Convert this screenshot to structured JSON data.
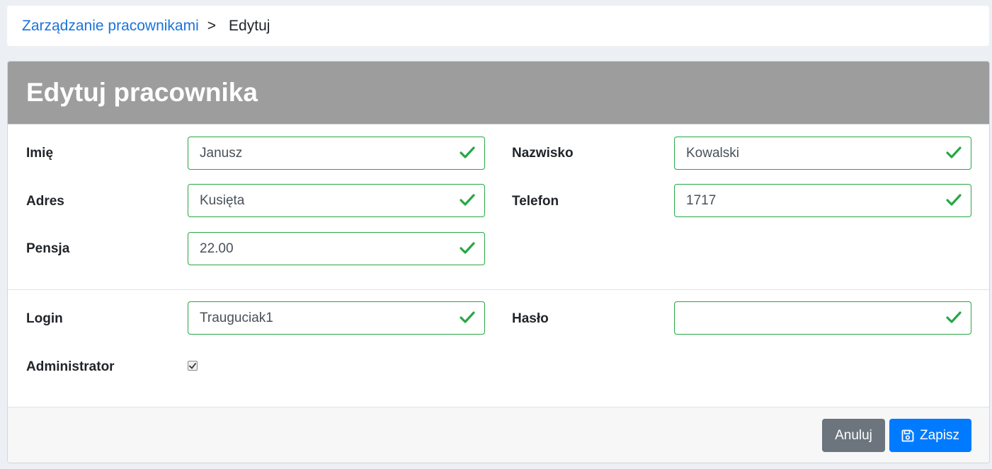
{
  "breadcrumb": {
    "parent": "Zarządzanie pracownikami",
    "separator": ">",
    "current": "Edytuj"
  },
  "card": {
    "title": "Edytuj pracownika"
  },
  "form": {
    "first_name": {
      "label": "Imię",
      "value": "Janusz"
    },
    "last_name": {
      "label": "Nazwisko",
      "value": "Kowalski"
    },
    "address": {
      "label": "Adres",
      "value": "Kusięta"
    },
    "phone": {
      "label": "Telefon",
      "value": "1717"
    },
    "salary": {
      "label": "Pensja",
      "value": "22.00"
    },
    "login": {
      "label": "Login",
      "value": "Trauguciak1"
    },
    "password": {
      "label": "Hasło",
      "value": ""
    },
    "admin": {
      "label": "Administrator",
      "checked": true
    }
  },
  "actions": {
    "cancel_label": "Anuluj",
    "save_label": "Zapisz"
  },
  "colors": {
    "link": "#1a73d9",
    "header_bg": "#9d9d9d",
    "valid_border": "#28a745",
    "cancel_bg": "#6c757d",
    "save_bg": "#007bff"
  },
  "icons": {
    "valid": "check-icon",
    "save": "floppy-disk-icon"
  }
}
